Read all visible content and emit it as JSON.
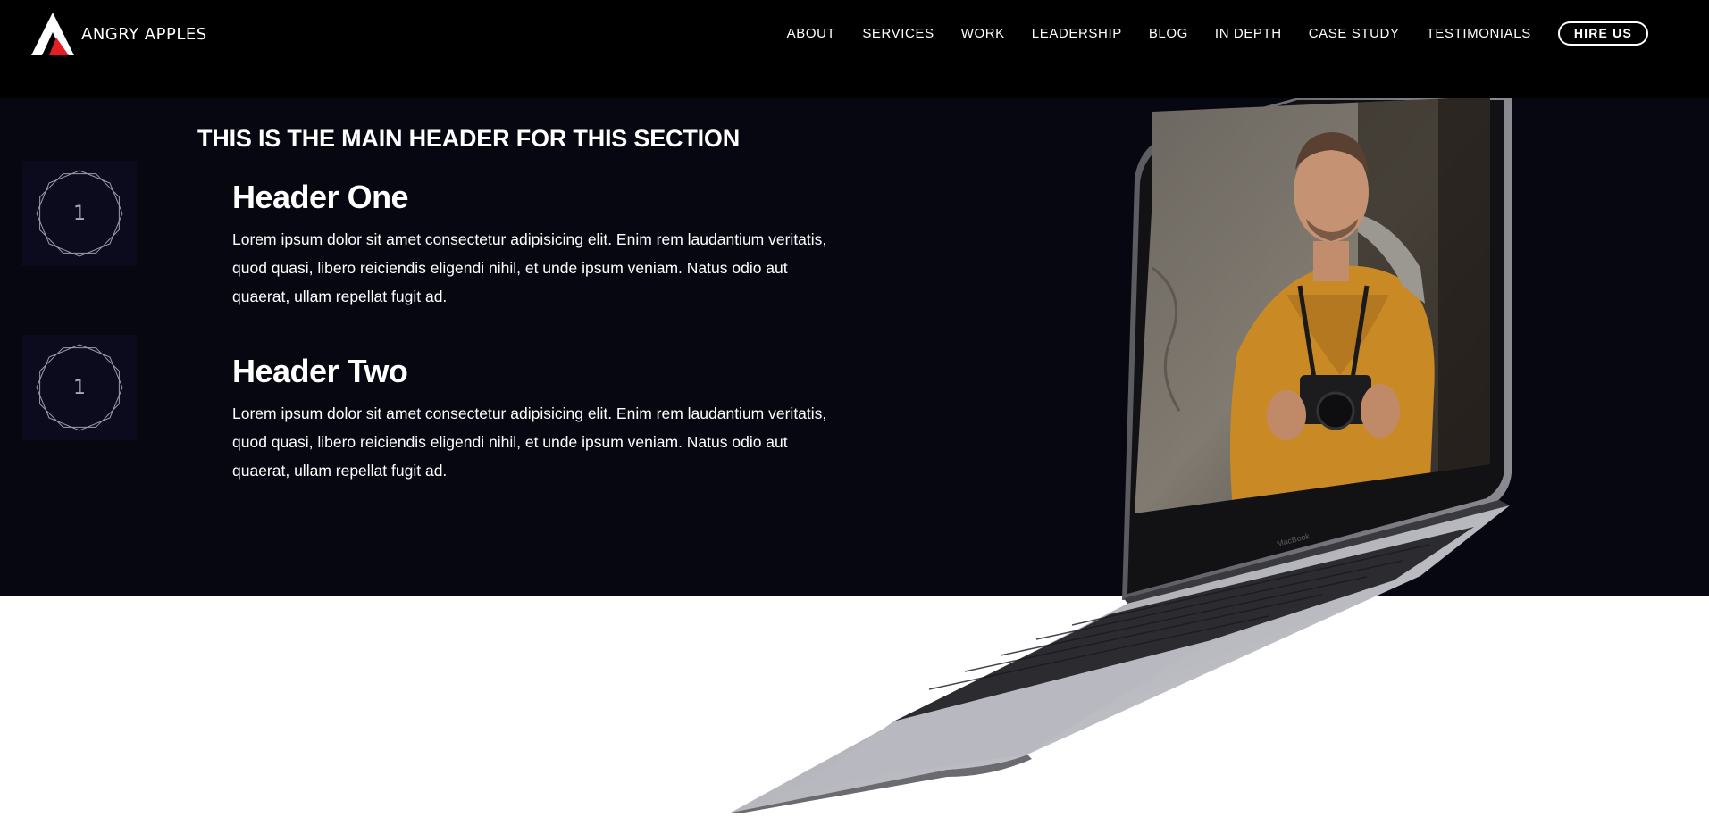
{
  "brand": {
    "name": "ANGRY APPLES",
    "accent_color": "#e31e24",
    "logo_icon": "triangle-logo-icon"
  },
  "nav": {
    "links": [
      "ABOUT",
      "SERVICES",
      "WORK",
      "LEADERSHIP",
      "BLOG",
      "IN DEPTH",
      "CASE STUDY",
      "TESTIMONIALS"
    ],
    "cta_label": "HIRE US"
  },
  "section": {
    "title": "THIS IS THE MAIN HEADER FOR THIS SECTION",
    "features": [
      {
        "number": "1",
        "heading": "Header One",
        "body": "Lorem ipsum dolor sit amet consectetur adipisicing elit. Enim rem laudantium veritatis, quod quasi, libero reiciendis eligendi nihil, et unde ipsum veniam. Natus odio aut quaerat, ullam repellat fugit ad."
      },
      {
        "number": "1",
        "heading": "Header Two",
        "body": "Lorem ipsum dolor sit amet consectetur adipisicing elit. Enim rem laudantium veritatis, quod quasi, libero reiciendis eligendi nihil, et unde ipsum veniam. Natus odio aut quaerat, ullam repellat fugit ad."
      }
    ]
  },
  "laptop": {
    "label": "MacBook",
    "image_subject": "photographer-with-camera"
  },
  "colors": {
    "navbar_bg": "#000000",
    "section_bg": "#070712",
    "page_bg": "#ffffff"
  }
}
